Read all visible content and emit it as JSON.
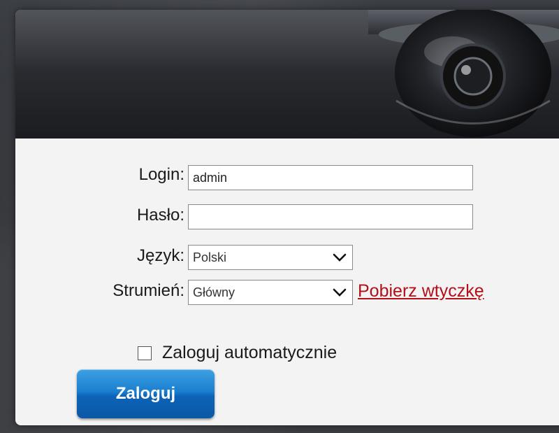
{
  "form": {
    "login_label": "Login:",
    "login_value": "admin",
    "password_label": "Hasło:",
    "password_value": "",
    "language_label": "Język:",
    "language_selected": "Polski",
    "stream_label": "Strumień:",
    "stream_selected": "Główny",
    "plugin_link": "Pobierz wtyczkę",
    "auto_login_label": "Zaloguj automatycznie",
    "auto_login_checked": false,
    "submit_label": "Zaloguj"
  },
  "icons": {
    "banner": "security-camera-dome-icon",
    "select_arrow": "chevron-down-icon",
    "checkbox": "checkbox-icon"
  },
  "colors": {
    "link": "#b3111a",
    "button": "#1a7fd0",
    "banner": "#2a2c31",
    "panel": "#f3f3f3"
  }
}
